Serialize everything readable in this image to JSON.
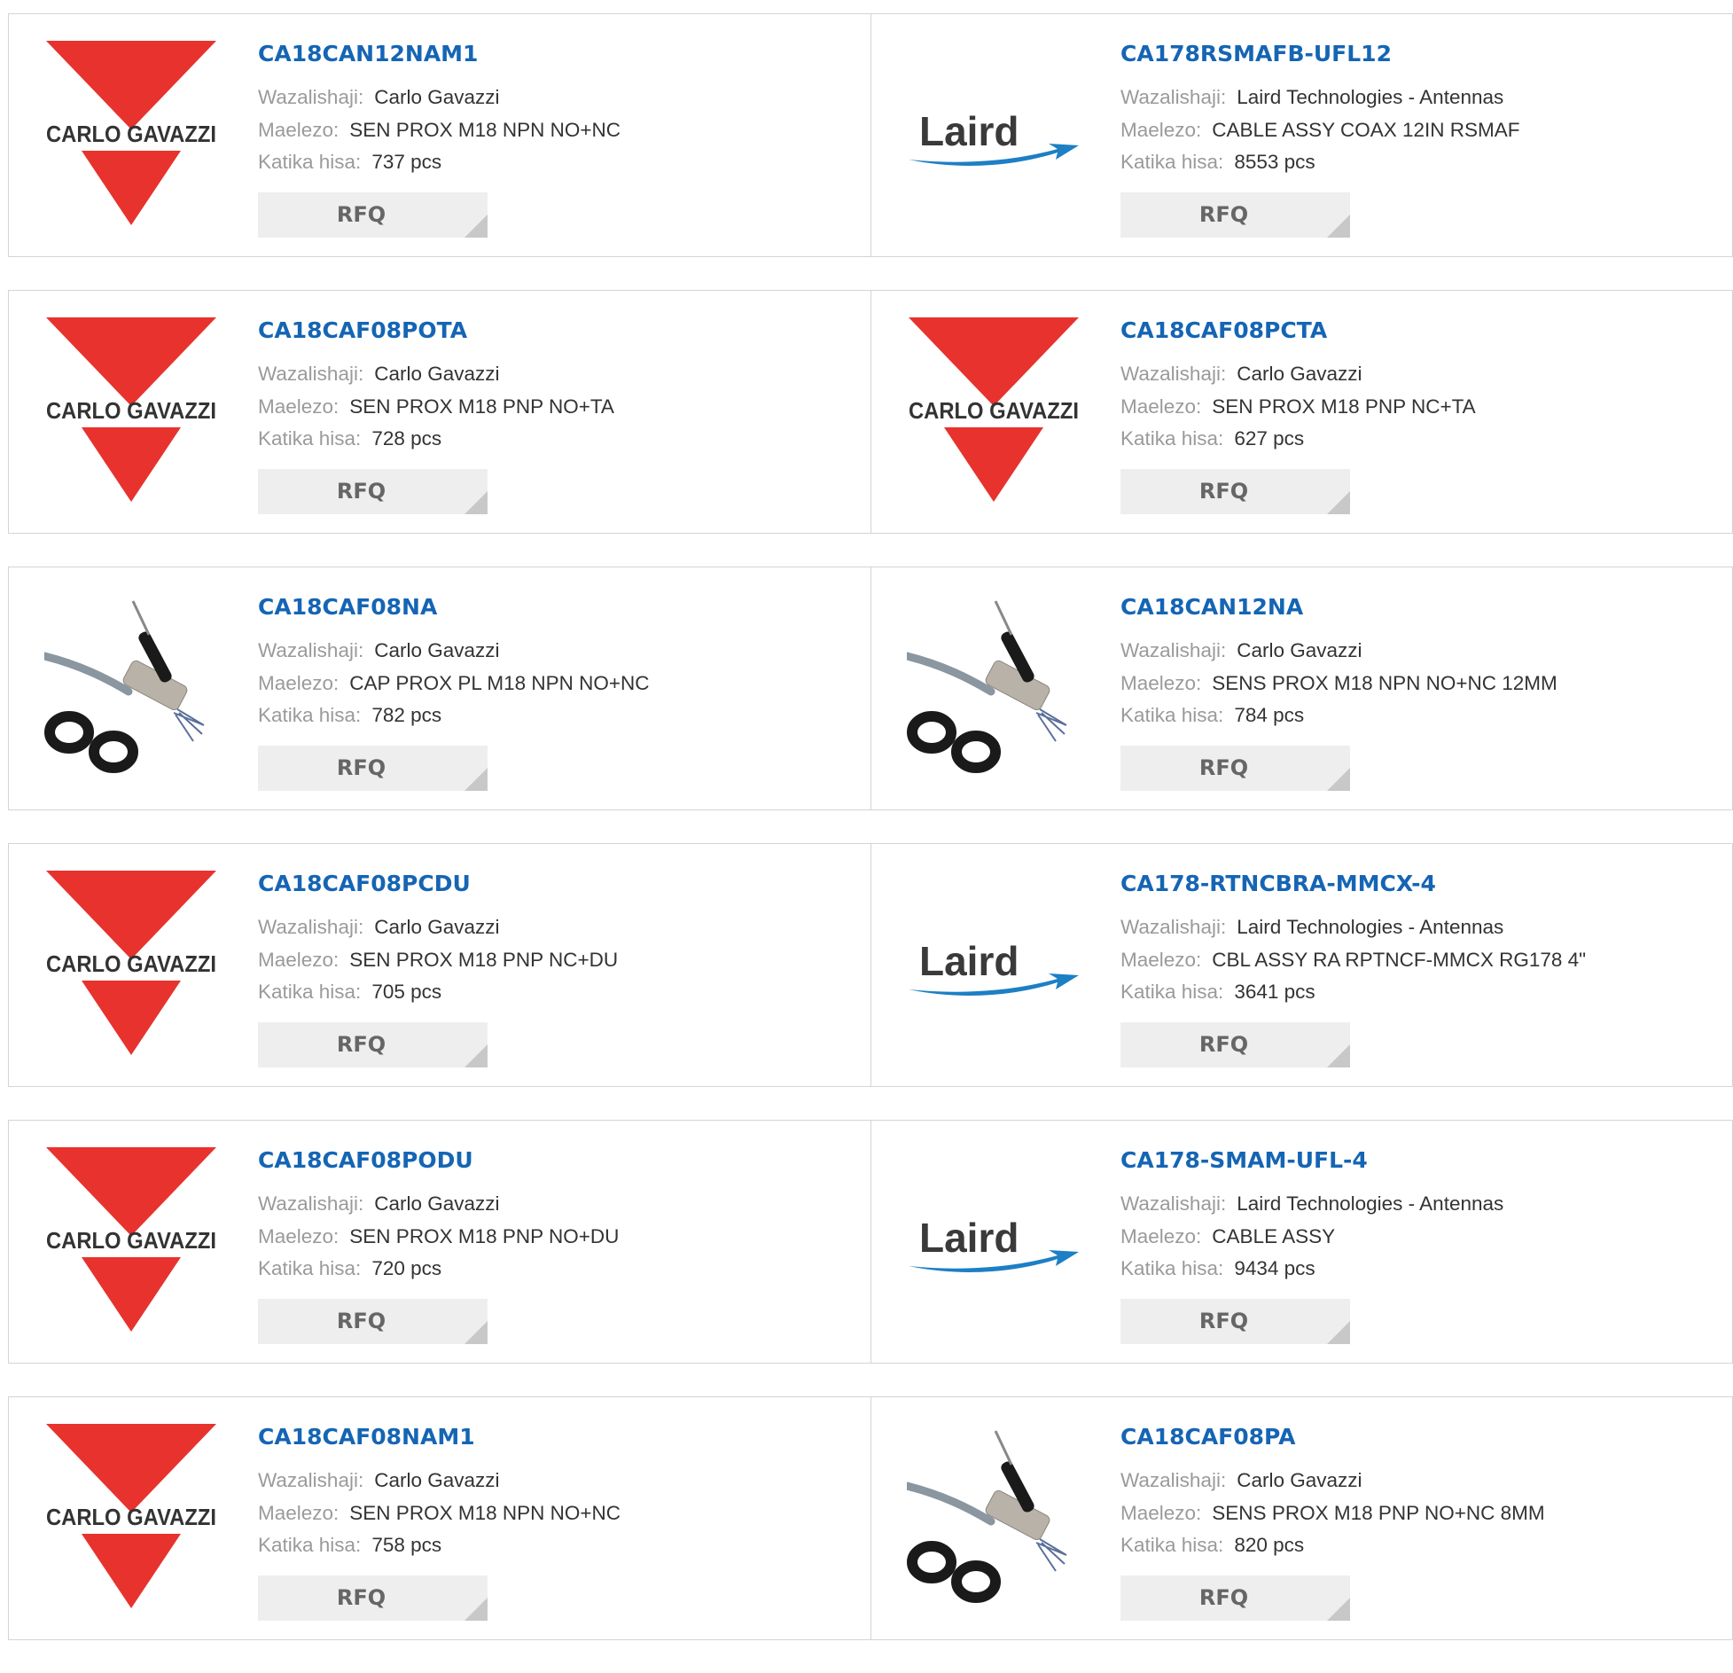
{
  "labels": {
    "manufacturer": "Wazalishaji:",
    "description": "Maelezo:",
    "stock": "Katika hisa:",
    "rfq": "RFQ"
  },
  "logos": {
    "carlo": "CARLO GAVAZZI",
    "laird": "Laird"
  },
  "colors": {
    "part_link": "#1565b4",
    "carlo_red": "#e8322d",
    "laird_blue": "#1d7fc4"
  },
  "products": [
    {
      "part": "CA18CAN12NAM1",
      "manufacturer": "Carlo Gavazzi",
      "description": "SEN PROX M18 NPN NO+NC",
      "stock": "737 pcs",
      "image": "carlo-gavazzi-logo"
    },
    {
      "part": "CA178RSMAFB-UFL12",
      "manufacturer": "Laird Technologies - Antennas",
      "description": "CABLE ASSY COAX 12IN RSMAF",
      "stock": "8553 pcs",
      "image": "laird-logo"
    },
    {
      "part": "CA18CAF08POTA",
      "manufacturer": "Carlo Gavazzi",
      "description": "SEN PROX M18 PNP NO+TA",
      "stock": "728 pcs",
      "image": "carlo-gavazzi-logo"
    },
    {
      "part": "CA18CAF08PCTA",
      "manufacturer": "Carlo Gavazzi",
      "description": "SEN PROX M18 PNP NC+TA",
      "stock": "627 pcs",
      "image": "carlo-gavazzi-logo"
    },
    {
      "part": "CA18CAF08NA",
      "manufacturer": "Carlo Gavazzi",
      "description": "CAP PROX PL M18 NPN NO+NC",
      "stock": "782 pcs",
      "image": "sensor-photo"
    },
    {
      "part": "CA18CAN12NA",
      "manufacturer": "Carlo Gavazzi",
      "description": "SENS PROX M18 NPN NO+NC 12MM",
      "stock": "784 pcs",
      "image": "sensor-photo"
    },
    {
      "part": "CA18CAF08PCDU",
      "manufacturer": "Carlo Gavazzi",
      "description": "SEN PROX M18 PNP NC+DU",
      "stock": "705 pcs",
      "image": "carlo-gavazzi-logo"
    },
    {
      "part": "CA178-RTNCBRA-MMCX-4",
      "manufacturer": "Laird Technologies - Antennas",
      "description": "CBL ASSY RA RPTNCF-MMCX RG178 4\"",
      "stock": "3641 pcs",
      "image": "laird-logo"
    },
    {
      "part": "CA18CAF08PODU",
      "manufacturer": "Carlo Gavazzi",
      "description": "SEN PROX M18 PNP NO+DU",
      "stock": "720 pcs",
      "image": "carlo-gavazzi-logo"
    },
    {
      "part": "CA178-SMAM-UFL-4",
      "manufacturer": "Laird Technologies - Antennas",
      "description": "CABLE ASSY",
      "stock": "9434 pcs",
      "image": "laird-logo"
    },
    {
      "part": "CA18CAF08NAM1",
      "manufacturer": "Carlo Gavazzi",
      "description": "SEN PROX M18 NPN NO+NC",
      "stock": "758 pcs",
      "image": "carlo-gavazzi-logo"
    },
    {
      "part": "CA18CAF08PA",
      "manufacturer": "Carlo Gavazzi",
      "description": "SENS PROX M18 PNP NO+NC 8MM",
      "stock": "820 pcs",
      "image": "sensor-photo"
    }
  ]
}
